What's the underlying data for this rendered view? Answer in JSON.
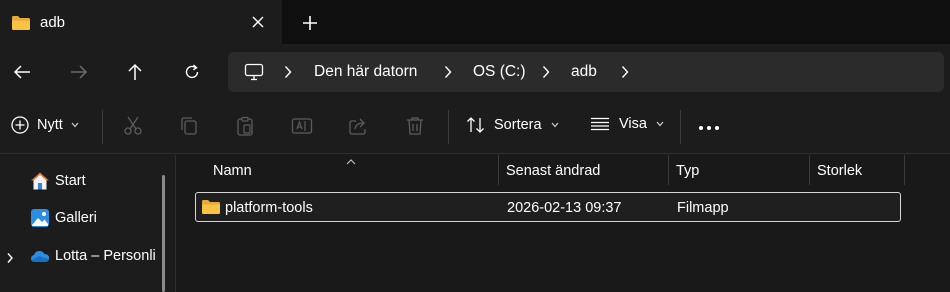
{
  "tab": {
    "title": "adb"
  },
  "address": {
    "crumbs": [
      "Den här datorn",
      "OS (C:)",
      "adb"
    ]
  },
  "commands": {
    "new_label": "Nytt",
    "sort_label": "Sortera",
    "view_label": "Visa"
  },
  "sidebar": {
    "items": [
      {
        "label": "Start",
        "icon": "home-icon"
      },
      {
        "label": "Galleri",
        "icon": "gallery-icon"
      },
      {
        "label": "Lotta – Personlig",
        "icon": "onedrive-cloud-icon"
      }
    ]
  },
  "columns": {
    "name": "Namn",
    "modified": "Senast ändrad",
    "type": "Typ",
    "size": "Storlek"
  },
  "files": [
    {
      "name": "platform-tools",
      "modified": "2026-02-13 09:37",
      "type": "Filmapp",
      "size": ""
    }
  ],
  "colors": {
    "accent": "#60cdff",
    "folder": "#f6c344",
    "background": "#191919"
  }
}
